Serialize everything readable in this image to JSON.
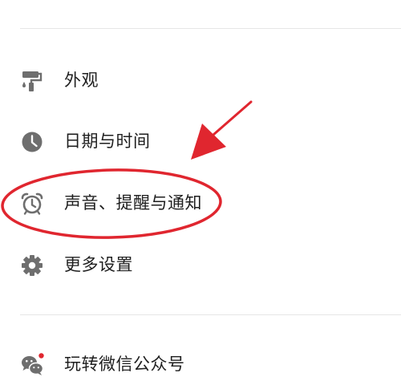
{
  "menu": {
    "items": [
      {
        "label": "外观",
        "icon": "paint-roller-icon"
      },
      {
        "label": "日期与时间",
        "icon": "clock-icon"
      },
      {
        "label": "声音、提醒与通知",
        "icon": "alarm-clock-icon"
      },
      {
        "label": "更多设置",
        "icon": "gear-icon"
      },
      {
        "label": "玩转微信公众号",
        "icon": "wechat-icon",
        "badge": true
      }
    ]
  },
  "colors": {
    "icon": "#6e6e6e",
    "text": "#1f1f1f",
    "annotation": "#e0262f",
    "badge": "#e0262f",
    "divider": "#e6e6e6"
  }
}
